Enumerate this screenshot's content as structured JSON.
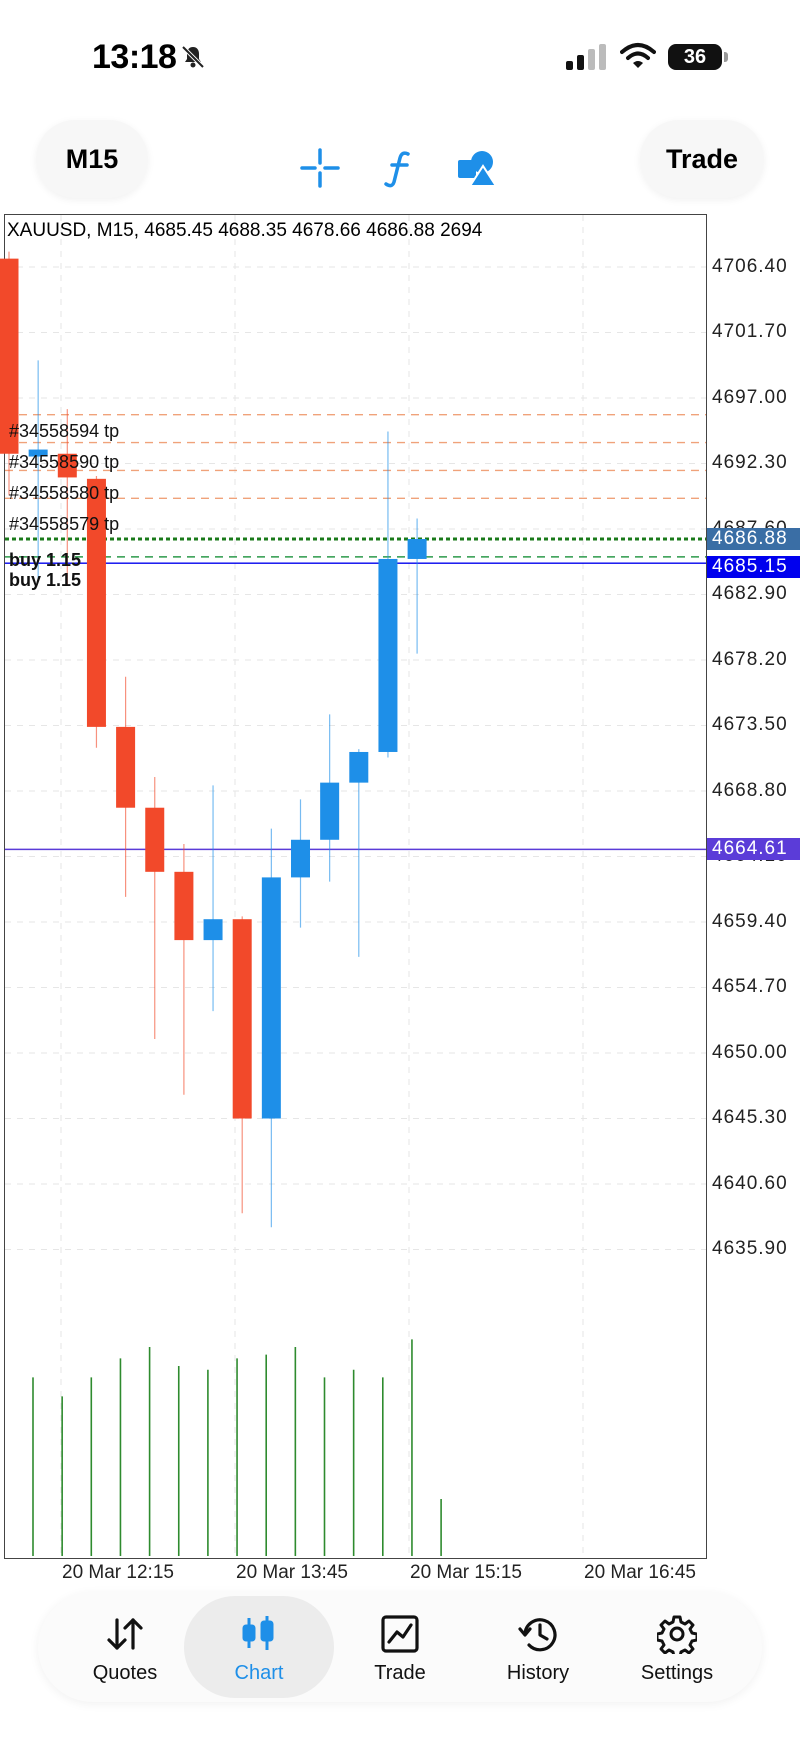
{
  "status_bar": {
    "time": "13:18",
    "battery": "36",
    "icons": [
      "bell-slash-icon",
      "signal-icon",
      "wifi-icon",
      "battery-icon"
    ]
  },
  "toolbar": {
    "timeframe": "M15",
    "trade_label": "Trade",
    "icons": [
      "crosshair-icon",
      "function-icon",
      "shapes-icon"
    ],
    "accent_color": "#1e8fe8"
  },
  "chart": {
    "header": "XAUUSD, M15, 4685.45 4688.35 4678.66 4686.88 2694",
    "price_tags": [
      {
        "value": "4686.88",
        "color": "#3a6ea5"
      },
      {
        "value": "4685.15",
        "color": "#0000ee"
      },
      {
        "value": "4664.61",
        "color": "#5b3cd8"
      }
    ],
    "tp_labels": [
      "#34558594 tp",
      "#34558590 tp",
      "#34558580 tp",
      "#34558579 tp"
    ],
    "buy_labels": [
      "buy 1.15",
      "buy 1.15"
    ]
  },
  "chart_data": {
    "type": "candlestick",
    "symbol": "XAUUSD",
    "timeframe": "M15",
    "y_ticks": [
      4706.4,
      4701.7,
      4697.0,
      4692.3,
      4687.6,
      4682.9,
      4678.2,
      4673.5,
      4668.8,
      4664.1,
      4659.4,
      4654.7,
      4650.0,
      4645.3,
      4640.6,
      4635.9
    ],
    "y_tick_labels": [
      "4706.40",
      "4701.70",
      "4697.00",
      "4692.30",
      "4687.60",
      "4682.90",
      "4678.20",
      "4673.50",
      "4668.80",
      "4664.10",
      "4659.40",
      "4654.70",
      "4650.00",
      "4645.30",
      "4640.60",
      "4635.90"
    ],
    "ylim": [
      4629.0,
      4709.0
    ],
    "x_labels": [
      "20 Mar 12:15",
      "20 Mar 13:45",
      "20 Mar 15:15",
      "20 Mar 16:45"
    ],
    "candles": [
      {
        "o": 4707.0,
        "h": 4707.5,
        "l": 4690.0,
        "c": 4693.0
      },
      {
        "o": 4692.8,
        "h": 4699.7,
        "l": 4683.9,
        "c": 4693.3
      },
      {
        "o": 4693.0,
        "h": 4696.2,
        "l": 4683.6,
        "c": 4691.3
      },
      {
        "o": 4691.2,
        "h": 4691.4,
        "l": 4671.9,
        "c": 4673.4
      },
      {
        "o": 4673.4,
        "h": 4677.0,
        "l": 4661.2,
        "c": 4667.6
      },
      {
        "o": 4667.6,
        "h": 4669.8,
        "l": 4651.0,
        "c": 4663.0
      },
      {
        "o": 4663.0,
        "h": 4665.0,
        "l": 4647.0,
        "c": 4658.1
      },
      {
        "o": 4658.1,
        "h": 4669.2,
        "l": 4653.0,
        "c": 4659.6
      },
      {
        "o": 4659.6,
        "h": 4659.8,
        "l": 4638.5,
        "c": 4645.3
      },
      {
        "o": 4645.3,
        "h": 4666.1,
        "l": 4637.5,
        "c": 4662.6
      },
      {
        "o": 4662.6,
        "h": 4668.2,
        "l": 4659.0,
        "c": 4665.3
      },
      {
        "o": 4665.3,
        "h": 4674.3,
        "l": 4662.3,
        "c": 4669.4
      },
      {
        "o": 4669.4,
        "h": 4671.8,
        "l": 4656.9,
        "c": 4671.6
      },
      {
        "o": 4671.6,
        "h": 4694.6,
        "l": 4671.2,
        "c": 4685.45
      },
      {
        "o": 4685.45,
        "h": 4688.35,
        "l": 4678.66,
        "c": 4686.88
      }
    ],
    "volumes": [
      0.47,
      0.42,
      0.47,
      0.52,
      0.55,
      0.5,
      0.49,
      0.52,
      0.53,
      0.55,
      0.47,
      0.49,
      0.47,
      0.57,
      0.15
    ],
    "horizontal_lines": [
      {
        "label": "tp",
        "price": 4695.8,
        "style": "dashed",
        "color": "#f0a27a"
      },
      {
        "label": "tp",
        "price": 4693.8,
        "style": "dashed",
        "color": "#f0a27a"
      },
      {
        "label": "tp",
        "price": 4691.8,
        "style": "dashed",
        "color": "#f0a27a"
      },
      {
        "label": "tp",
        "price": 4689.8,
        "style": "dashed",
        "color": "#f0a27a"
      },
      {
        "label": "bid",
        "price": 4686.88,
        "style": "dotted",
        "color": "#1a7a1a"
      },
      {
        "label": "buy",
        "price": 4685.6,
        "style": "dashed",
        "color": "#2c9a4a"
      },
      {
        "label": "ask",
        "price": 4685.15,
        "style": "solid",
        "color": "#0000ee"
      },
      {
        "label": "level",
        "price": 4664.61,
        "style": "solid",
        "color": "#5b3cd8"
      }
    ],
    "bull_color": "#1e8fe8",
    "bear_color": "#f2492a",
    "volume_color": "#2e8b2e",
    "grid": true
  },
  "tabs": [
    {
      "label": "Quotes",
      "icon": "quotes-arrows-icon",
      "active": false
    },
    {
      "label": "Chart",
      "icon": "candlestick-icon",
      "active": true
    },
    {
      "label": "Trade",
      "icon": "trade-chart-icon",
      "active": false
    },
    {
      "label": "History",
      "icon": "history-clock-icon",
      "active": false
    },
    {
      "label": "Settings",
      "icon": "gear-icon",
      "active": false
    }
  ]
}
